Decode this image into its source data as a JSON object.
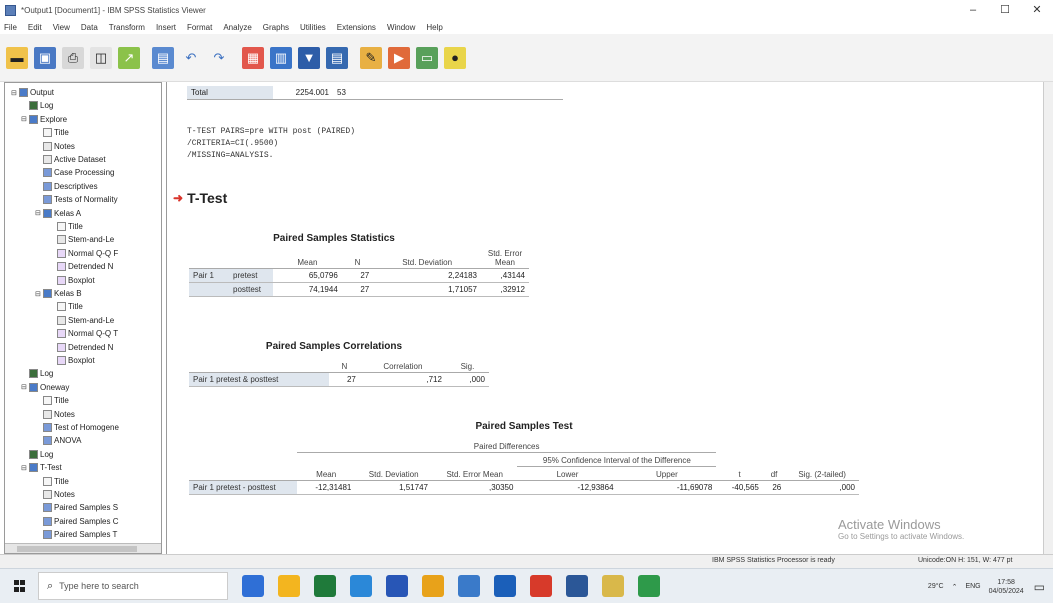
{
  "window": {
    "title": "*Output1 [Document1] - IBM SPSS Statistics Viewer",
    "minimize": "–",
    "maximize": "☐",
    "close": "✕"
  },
  "menu": [
    "File",
    "Edit",
    "View",
    "Data",
    "Transform",
    "Insert",
    "Format",
    "Analyze",
    "Graphs",
    "Utilities",
    "Extensions",
    "Window",
    "Help"
  ],
  "toolbar": {
    "icons": [
      "open-folder-icon",
      "save-icon",
      "print-icon",
      "print-preview-icon",
      "export-icon",
      "recall-dialog-icon",
      "undo-icon",
      "redo-icon",
      "goto-data-icon",
      "goto-case-icon",
      "goto-variable-icon",
      "variables-icon",
      "designate-window-icon",
      "insert-output-icon",
      "insert-text-icon",
      "insert-heading-icon"
    ]
  },
  "nav": {
    "items": [
      {
        "label": "Output",
        "icon": "book",
        "toggle": "⊟",
        "level": 0
      },
      {
        "label": "Log",
        "icon": "log",
        "toggle": "",
        "level": 1
      },
      {
        "label": "Explore",
        "icon": "book",
        "toggle": "⊟",
        "level": 1
      },
      {
        "label": "Title",
        "icon": "text",
        "toggle": "",
        "level": 2
      },
      {
        "label": "Notes",
        "icon": "doc",
        "toggle": "",
        "level": 2
      },
      {
        "label": "Active Dataset",
        "icon": "doc",
        "toggle": "",
        "level": 2
      },
      {
        "label": "Case Processing",
        "icon": "tbl",
        "toggle": "",
        "level": 2
      },
      {
        "label": "Descriptives",
        "icon": "tbl",
        "toggle": "",
        "level": 2
      },
      {
        "label": "Tests of Normality",
        "icon": "tbl",
        "toggle": "",
        "level": 2
      },
      {
        "label": "Kelas A",
        "icon": "book",
        "toggle": "⊟",
        "level": 2
      },
      {
        "label": "Title",
        "icon": "text",
        "toggle": "",
        "level": 3
      },
      {
        "label": "Stem-and-Le",
        "icon": "doc",
        "toggle": "",
        "level": 3
      },
      {
        "label": "Normal Q-Q F",
        "icon": "chart",
        "toggle": "",
        "level": 3
      },
      {
        "label": "Detrended N",
        "icon": "chart",
        "toggle": "",
        "level": 3
      },
      {
        "label": "Boxplot",
        "icon": "chart",
        "toggle": "",
        "level": 3
      },
      {
        "label": "Kelas B",
        "icon": "book",
        "toggle": "⊟",
        "level": 2
      },
      {
        "label": "Title",
        "icon": "text",
        "toggle": "",
        "level": 3
      },
      {
        "label": "Stem-and-Le",
        "icon": "doc",
        "toggle": "",
        "level": 3
      },
      {
        "label": "Normal Q-Q T",
        "icon": "chart",
        "toggle": "",
        "level": 3
      },
      {
        "label": "Detrended N",
        "icon": "chart",
        "toggle": "",
        "level": 3
      },
      {
        "label": "Boxplot",
        "icon": "chart",
        "toggle": "",
        "level": 3
      },
      {
        "label": "Log",
        "icon": "log",
        "toggle": "",
        "level": 1
      },
      {
        "label": "Oneway",
        "icon": "book",
        "toggle": "⊟",
        "level": 1
      },
      {
        "label": "Title",
        "icon": "text",
        "toggle": "",
        "level": 2
      },
      {
        "label": "Notes",
        "icon": "doc",
        "toggle": "",
        "level": 2
      },
      {
        "label": "Test of Homogene",
        "icon": "tbl",
        "toggle": "",
        "level": 2
      },
      {
        "label": "ANOVA",
        "icon": "tbl",
        "toggle": "",
        "level": 2
      },
      {
        "label": "Log",
        "icon": "log",
        "toggle": "",
        "level": 1
      },
      {
        "label": "T-Test",
        "icon": "book",
        "toggle": "⊟",
        "level": 1
      },
      {
        "label": "Title",
        "icon": "text",
        "toggle": "",
        "level": 2
      },
      {
        "label": "Notes",
        "icon": "doc",
        "toggle": "",
        "level": 2
      },
      {
        "label": "Paired Samples S",
        "icon": "tbl",
        "toggle": "",
        "level": 2
      },
      {
        "label": "Paired Samples C",
        "icon": "tbl",
        "toggle": "",
        "level": 2
      },
      {
        "label": "Paired Samples T",
        "icon": "tbl",
        "toggle": "",
        "level": 2
      }
    ]
  },
  "output": {
    "total_row": {
      "label": "Total",
      "v1": "2254.001",
      "v2": "53"
    },
    "syntax": [
      "T-TEST PAIRS=pre WITH post (PAIRED)",
      "  /CRITERIA=CI(.9500)",
      "  /MISSING=ANALYSIS."
    ],
    "section_title": "T-Test",
    "stats": {
      "title": "Paired Samples Statistics",
      "headers": [
        "",
        "",
        "Mean",
        "N",
        "Std. Deviation",
        "Std. Error Mean"
      ],
      "rows": [
        [
          "Pair 1",
          "pretest",
          "65,0796",
          "27",
          "2,24183",
          ",43144"
        ],
        [
          "",
          "posttest",
          "74,1944",
          "27",
          "1,71057",
          ",32912"
        ]
      ]
    },
    "corr": {
      "title": "Paired Samples Correlations",
      "headers": [
        "",
        "N",
        "Correlation",
        "Sig."
      ],
      "rows": [
        [
          "Pair 1   pretest & posttest",
          "27",
          ",712",
          ",000"
        ]
      ]
    },
    "test": {
      "title": "Paired Samples Test",
      "group_header": "Paired Differences",
      "ci_header": "95% Confidence Interval of the Difference",
      "headers": [
        "Mean",
        "Std. Deviation",
        "Std. Error Mean",
        "Lower",
        "Upper",
        "t",
        "df",
        "Sig. (2-tailed)"
      ],
      "row": [
        "Pair 1   pretest - posttest",
        "-12,31481",
        "1,51747",
        ",30350",
        "-12,93864",
        "-11,69078",
        "-40,565",
        "26",
        ",000"
      ]
    }
  },
  "watermark": {
    "line1": "Activate Windows",
    "line2": "Go to Settings to activate Windows."
  },
  "status": {
    "processor": "IBM SPSS Statistics Processor is ready",
    "unicode": "Unicode:ON   H: 151, W: 477 pt"
  },
  "taskbar": {
    "search_placeholder": "Type here to search",
    "temperature": "29°C",
    "lang": "ENG",
    "time": "17:58",
    "date": "04/05/2024",
    "app_colors": [
      "#2f6fd6",
      "#f3b51f",
      "#1f7a3a",
      "#2b88d8",
      "#2856b6",
      "#e8a21a",
      "#3a7ac9",
      "#1b5fb9",
      "#d73a2a",
      "#2b5797",
      "#d9b84a",
      "#2e9a4a"
    ]
  }
}
